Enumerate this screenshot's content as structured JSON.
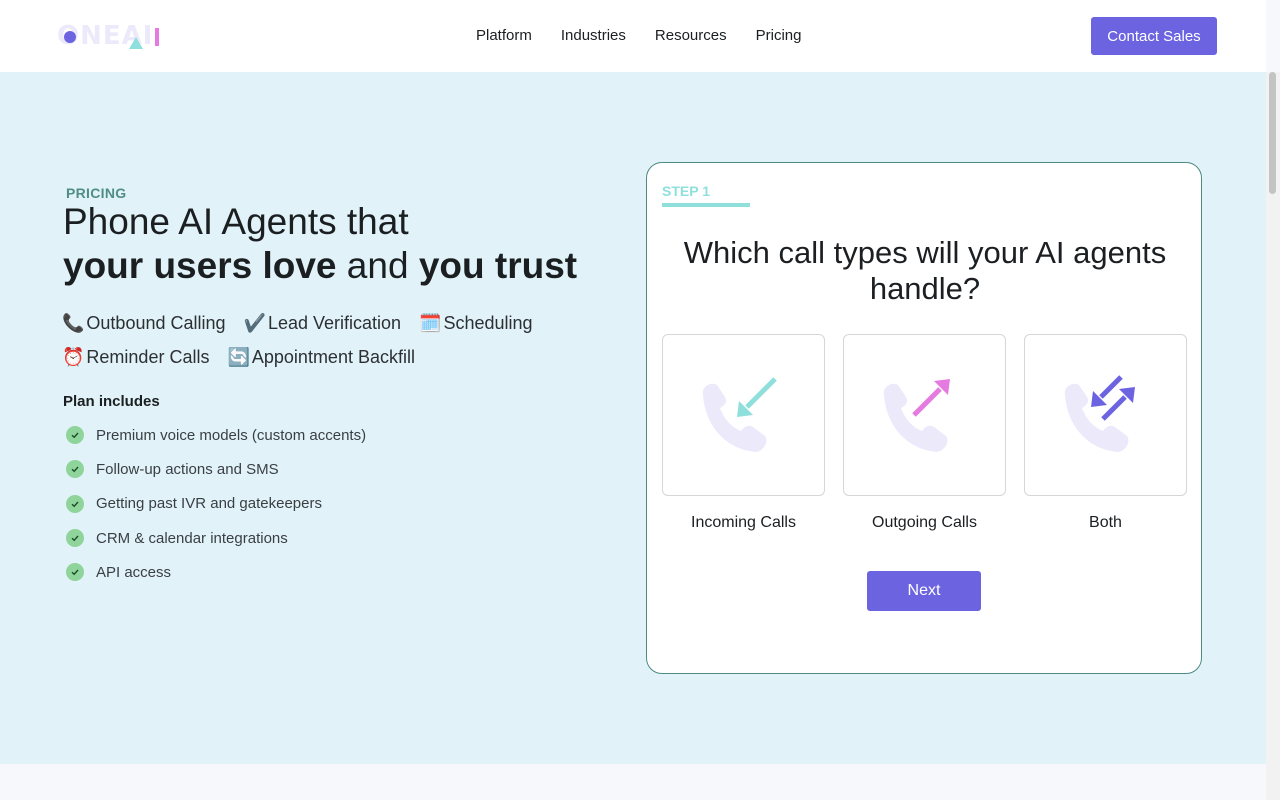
{
  "header": {
    "logo_text": "ONEAI",
    "nav": [
      "Platform",
      "Industries",
      "Resources",
      "Pricing"
    ],
    "contact_label": "Contact Sales"
  },
  "hero": {
    "eyebrow": "PRICING",
    "headline_line1": "Phone AI Agents that",
    "headline_bold1": "your users love",
    "headline_mid": " and ",
    "headline_bold2": "you trust",
    "tags_row1": [
      {
        "emoji": "📞",
        "label": "Outbound Calling"
      },
      {
        "emoji": "✔️",
        "label": "Lead Verification"
      },
      {
        "emoji": "🗓️",
        "label": "Scheduling"
      }
    ],
    "tags_row2": [
      {
        "emoji": "⏰",
        "label": "Reminder Calls"
      },
      {
        "emoji": "🔄",
        "label": "Appointment Backfill"
      }
    ],
    "plan_title": "Plan includes",
    "plan_items": [
      "Premium voice models (custom accents)",
      "Follow-up actions and SMS",
      "Getting past IVR and gatekeepers",
      "CRM & calendar integrations",
      "API access"
    ]
  },
  "card": {
    "step_label": "STEP 1",
    "question": "Which call types will your AI agents handle?",
    "options": [
      {
        "label": "Incoming Calls",
        "icon": "incoming-call-icon",
        "arrow_color": "#8fe0dc"
      },
      {
        "label": "Outgoing Calls",
        "icon": "outgoing-call-icon",
        "arrow_color": "#e57ae0"
      },
      {
        "label": "Both",
        "icon": "both-calls-icon",
        "arrow_color": "#6c63e0"
      }
    ],
    "next_label": "Next"
  },
  "colors": {
    "accent": "#6c63e0",
    "hero_bg": "#e1f3f8",
    "teal": "#8fe0dc",
    "check_green": "#8fd49a"
  }
}
